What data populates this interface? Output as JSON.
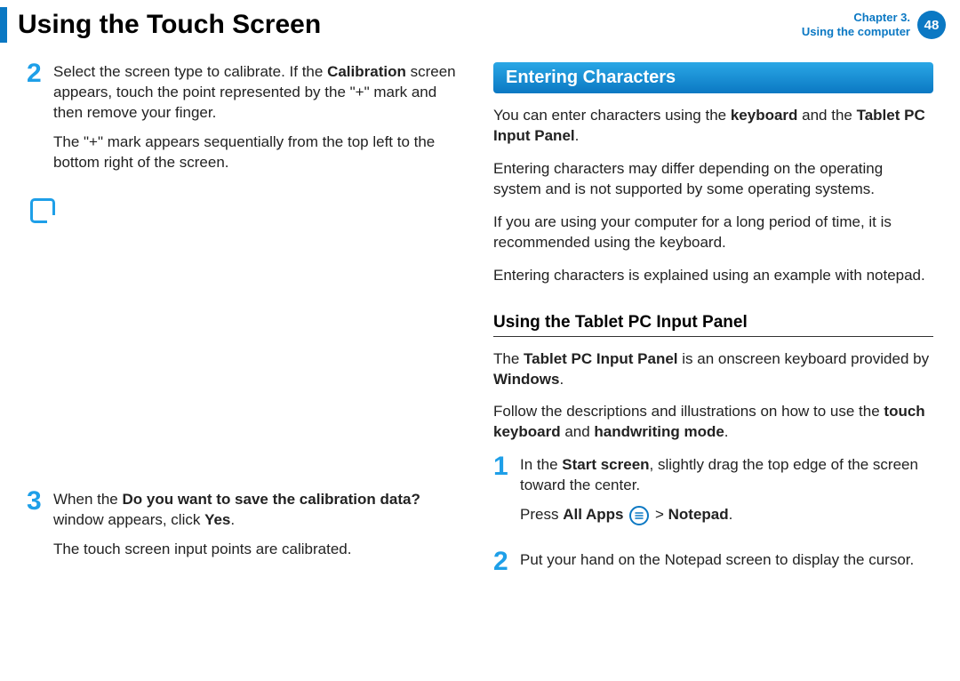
{
  "header": {
    "title": "Using the Touch Screen",
    "chapter_label": "Chapter 3.",
    "chapter_sub": "Using the computer",
    "page_number": "48"
  },
  "left": {
    "step2": {
      "num": "2",
      "p1_a": "Select the screen type to calibrate. If the ",
      "p1_b": "Calibration",
      "p1_c": " screen appears, touch the point represented by the \"+\" mark and then remove your finger.",
      "p2": "The \"+\" mark appears sequentially from the top left to the bottom right of the screen."
    },
    "step3": {
      "num": "3",
      "p1_a": "When the ",
      "p1_b": "Do you want to save the calibration data?",
      "p1_c": " window appears, click ",
      "p1_d": "Yes",
      "p1_e": ".",
      "p2": "The touch screen input points are calibrated."
    }
  },
  "right": {
    "section_title": "Entering Characters",
    "p1_a": "You can enter characters using the ",
    "p1_b": "keyboard",
    "p1_c": " and the ",
    "p1_d": "Tablet PC Input Panel",
    "p1_e": ".",
    "p2": "Entering characters may differ depending on the operating system and is not supported by some operating systems.",
    "p3": "If you are using your computer for a long period of time, it is recommended using the keyboard.",
    "p4": "Entering characters is explained using an example with notepad.",
    "sub_title": "Using the Tablet PC Input Panel",
    "sub_p1_a": "The ",
    "sub_p1_b": "Tablet PC Input Panel",
    "sub_p1_c": " is an onscreen keyboard provided by ",
    "sub_p1_d": "Windows",
    "sub_p1_e": ".",
    "sub_p2_a": "Follow the descriptions and illustrations on how to use the ",
    "sub_p2_b": "touch keyboard",
    "sub_p2_c": " and ",
    "sub_p2_d": "handwriting mode",
    "sub_p2_e": ".",
    "step1": {
      "num": "1",
      "p1_a": "In the ",
      "p1_b": "Start screen",
      "p1_c": ", slightly drag the top edge of the screen toward the center.",
      "p2_a": "Press ",
      "p2_b": "All Apps",
      "p2_c": " > ",
      "p2_d": "Notepad",
      "p2_e": "."
    },
    "step2": {
      "num": "2",
      "p1": "Put your hand on the Notepad screen to display the cursor."
    }
  }
}
